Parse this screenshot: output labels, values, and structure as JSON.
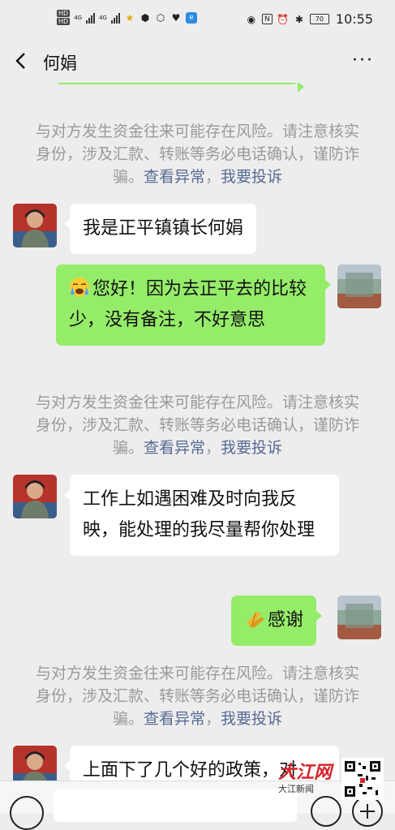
{
  "status_bar": {
    "left_badges": [
      "HD",
      "HD"
    ],
    "network_labels": [
      "4G",
      "4G"
    ],
    "battery": "70",
    "time": "10:55"
  },
  "nav": {
    "title": "何娟"
  },
  "notice": {
    "text": "与对方发生资金往来可能存在风险。请注意核实身份，涉及汇款、转账等务必电话确认，谨防诈骗。",
    "link_check": "查看异常",
    "separator": "，",
    "link_report": "我要投诉"
  },
  "messages": [
    {
      "side": "left",
      "text": "我是正平镇镇长何娟"
    },
    {
      "side": "right",
      "emoji": "crying-face",
      "text": "您好！因为去正平去的比较少，没有备注，不好意思"
    },
    {
      "side": "left",
      "text": "工作上如遇困难及时向我反映，能处理的我尽量帮你处理"
    },
    {
      "side": "right",
      "emoji": "folded-hands",
      "text": "感谢"
    },
    {
      "side": "left",
      "text": "上面下了几个好的政策，对"
    }
  ],
  "watermark": {
    "brand": "大江网",
    "sub": "大江新闻"
  },
  "colors": {
    "background": "#ededed",
    "bubble_self": "#95ec69",
    "bubble_other": "#ffffff",
    "link": "#576b95",
    "notice_text": "#9a9a9a"
  },
  "icons": [
    "back-arrow-icon",
    "more-icon",
    "voice-icon",
    "emoji-icon",
    "plus-icon"
  ]
}
